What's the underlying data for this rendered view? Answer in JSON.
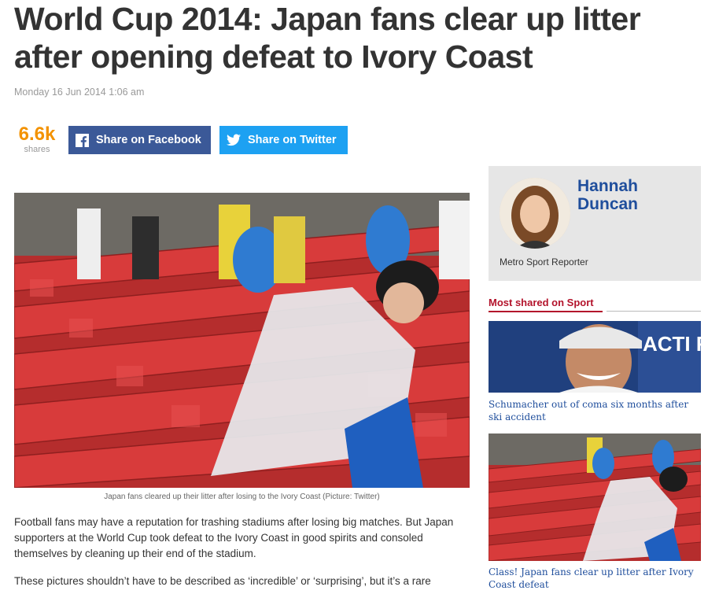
{
  "article": {
    "headline": "World Cup 2014: Japan fans clear up litter after opening defeat to Ivory Coast",
    "dateline": "Monday 16 Jun 2014 1:06 am",
    "shares": {
      "count": "6.6k",
      "label": "shares"
    },
    "share_buttons": {
      "facebook_label": "Share on Facebook",
      "twitter_label": "Share on Twitter",
      "facebook_icon": "facebook-icon",
      "twitter_icon": "twitter-bird-icon"
    },
    "photo_caption": "Japan fans cleared up their litter after losing to the Ivory Coast (Picture: Twitter)",
    "paragraphs": [
      "Football fans may have a reputation for trashing stadiums after losing big matches. But Japan supporters at the World Cup took defeat to the Ivory Coast in good spirits and consoled themselves by cleaning up their end of the stadium.",
      "These pictures shouldn’t have to be described as ‘incredible’ or ‘surprising’, but it’s a rare"
    ]
  },
  "author": {
    "name": "Hannah Duncan",
    "role": "Metro Sport Reporter"
  },
  "sidebar": {
    "heading": "Most shared on Sport",
    "stories": [
      {
        "title": "Schumacher out of coma six months after ski accident",
        "thumb_banner": "ACTI ROAD S"
      },
      {
        "title": "Class! Japan fans clear up litter after Ivory Coast defeat"
      }
    ]
  },
  "colors": {
    "accent_orange": "#f39200",
    "facebook_blue": "#3b5998",
    "twitter_blue": "#1da1f2",
    "link_blue": "#1f4e9c",
    "section_red": "#b3132b"
  }
}
